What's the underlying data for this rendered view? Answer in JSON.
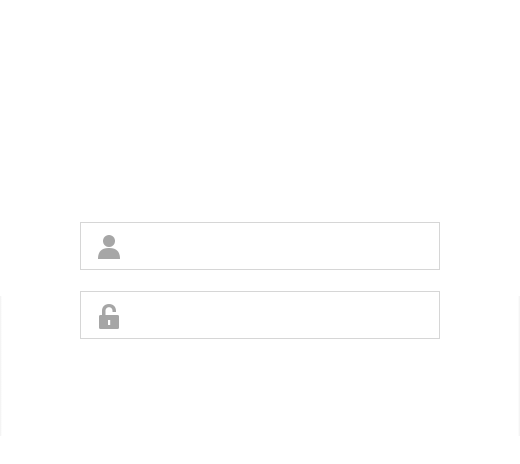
{
  "login": {
    "username": {
      "value": "",
      "placeholder": "",
      "icon": "user-icon"
    },
    "password": {
      "value": "",
      "placeholder": "",
      "icon": "lock-icon"
    }
  },
  "colors": {
    "field_border": "#d6d6d6",
    "icon": "#a6a6a6",
    "background": "#ffffff"
  }
}
